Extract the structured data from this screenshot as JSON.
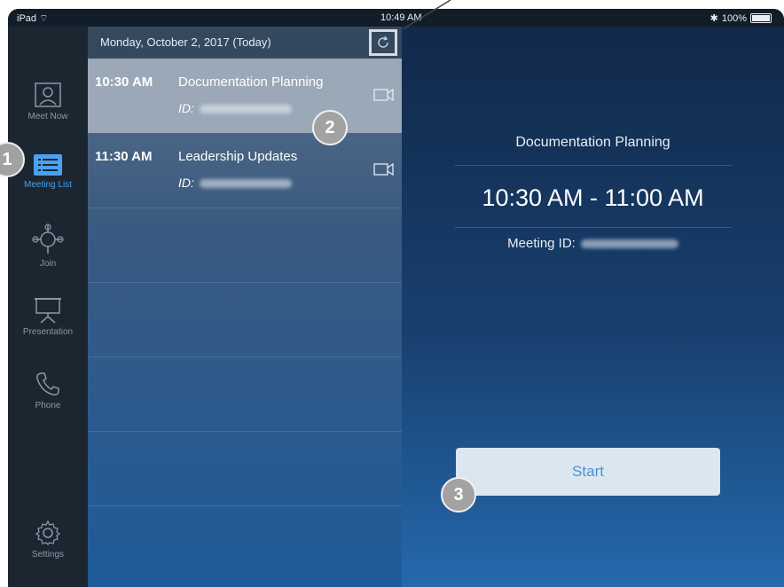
{
  "status_bar": {
    "device": "iPad",
    "time": "10:49 AM",
    "battery": "100%"
  },
  "rail": {
    "items": [
      {
        "label": "Meet Now",
        "icon": "person-icon"
      },
      {
        "label": "Meeting List",
        "icon": "list-icon",
        "active": true
      },
      {
        "label": "Join",
        "icon": "join-icon"
      },
      {
        "label": "Presentation",
        "icon": "presentation-icon"
      },
      {
        "label": "Phone",
        "icon": "phone-icon"
      },
      {
        "label": "Settings",
        "icon": "gear-icon"
      }
    ]
  },
  "list": {
    "date_header": "Monday, October 2, 2017 (Today)",
    "meetings": [
      {
        "time": "10:30 AM",
        "title": "Documentation Planning",
        "id_label": "ID:",
        "selected": true
      },
      {
        "time": "11:30 AM",
        "title": "Leadership Updates",
        "id_label": "ID:",
        "selected": false
      }
    ]
  },
  "detail": {
    "title": "Documentation Planning",
    "time_range": "10:30 AM - 11:00 AM",
    "meeting_id_label": "Meeting ID:",
    "start_label": "Start"
  },
  "callouts": [
    "1",
    "2",
    "3"
  ],
  "colors": {
    "accent": "#4aa1f0",
    "rail_bg": "#1b2631",
    "start_text": "#4e92d6"
  }
}
